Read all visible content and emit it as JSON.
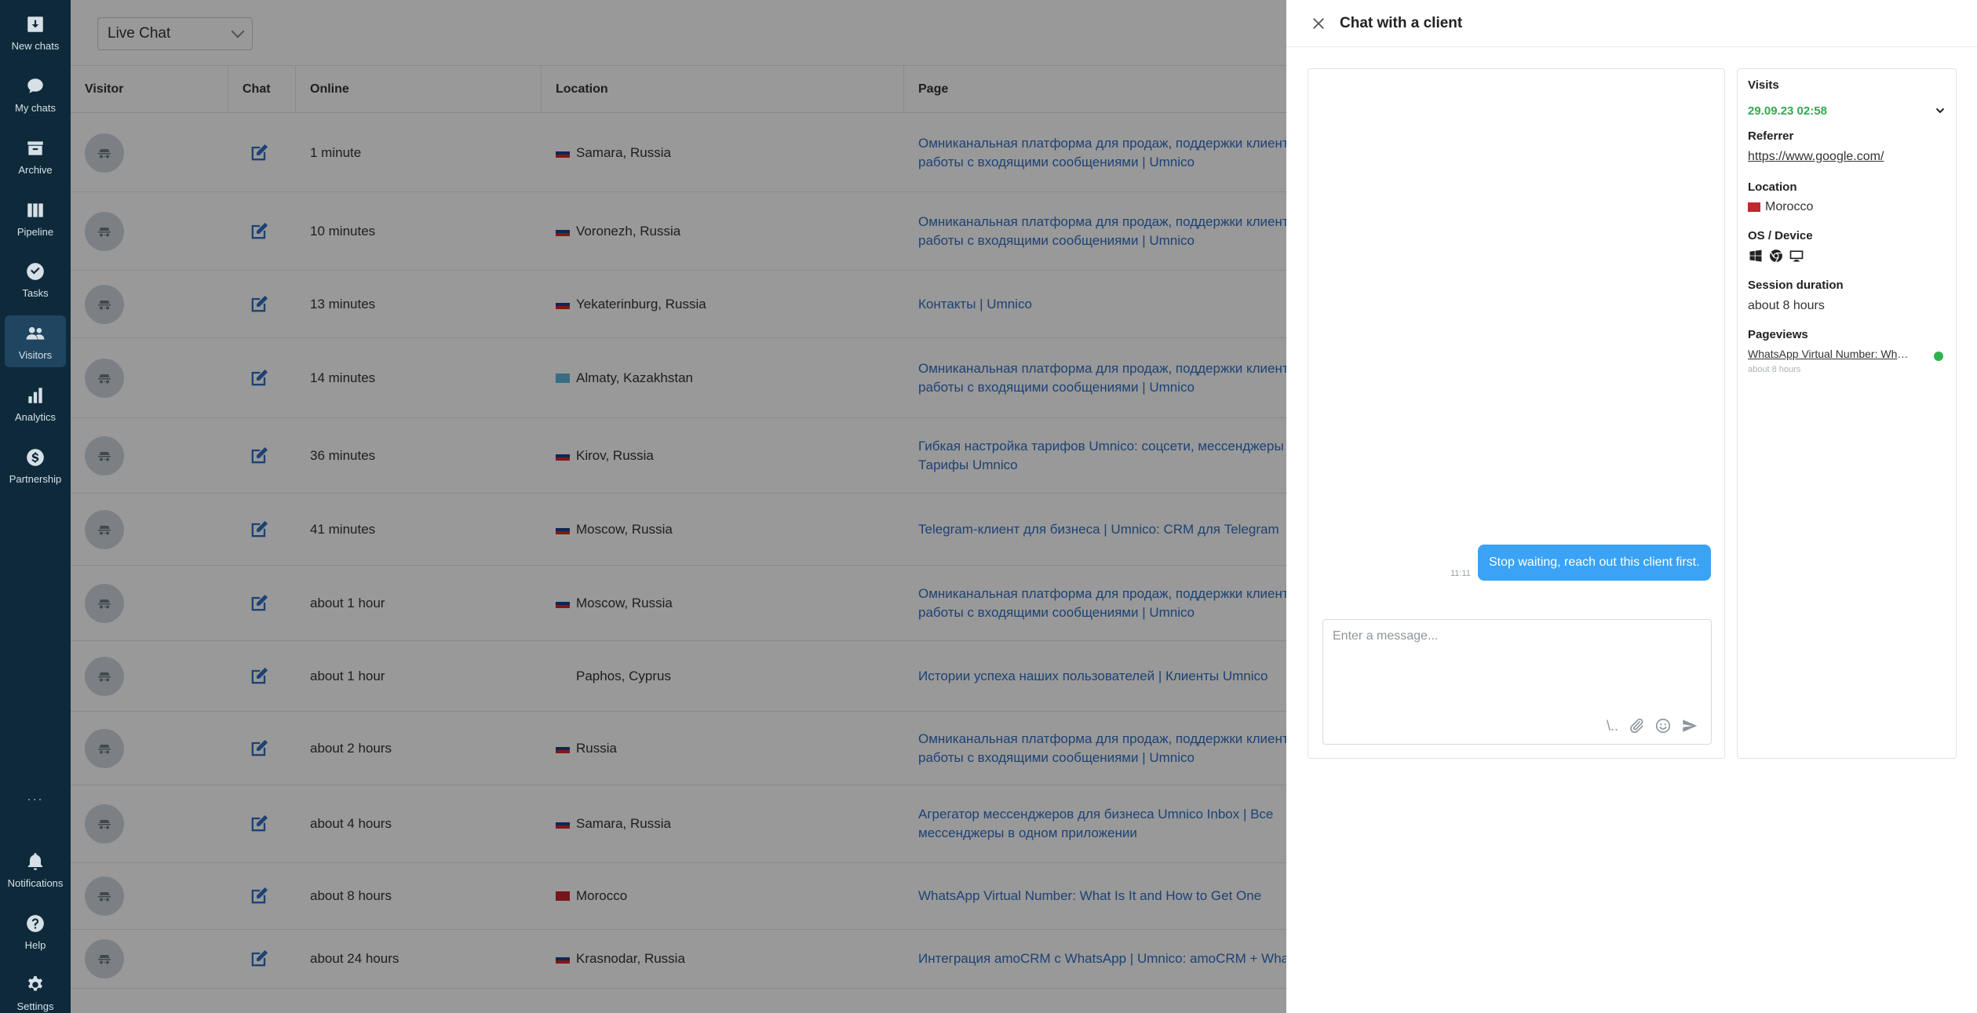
{
  "sidebar": {
    "items": [
      {
        "label": "New chats",
        "icon": "download-icon"
      },
      {
        "label": "My chats",
        "icon": "chat-bubble-icon"
      },
      {
        "label": "Archive",
        "icon": "archive-icon"
      },
      {
        "label": "Pipeline",
        "icon": "pipeline-icon"
      },
      {
        "label": "Tasks",
        "icon": "check-circle-icon"
      },
      {
        "label": "Visitors",
        "icon": "users-icon",
        "active": true
      },
      {
        "label": "Analytics",
        "icon": "bar-chart-icon"
      },
      {
        "label": "Partnership",
        "icon": "dollar-icon"
      },
      {
        "label": "Notifications",
        "icon": "bell-icon"
      },
      {
        "label": "Help",
        "icon": "question-icon"
      },
      {
        "label": "Settings",
        "icon": "gear-icon"
      }
    ],
    "more": "..."
  },
  "toolbar": {
    "channel_select": "Live Chat"
  },
  "table": {
    "headers": {
      "visitor": "Visitor",
      "chat": "Chat",
      "online": "Online",
      "location": "Location",
      "page": "Page"
    },
    "rows": [
      {
        "online": "1 minute",
        "location": "Samara, Russia",
        "flag": "ru",
        "page_l1": "Омниканальная платформа для продаж, поддержки клиент",
        "page_l2": "работы с входящими сообщениями | Umnico"
      },
      {
        "online": "10 minutes",
        "location": "Voronezh, Russia",
        "flag": "ru",
        "page_l1": "Омниканальная платформа для продаж, поддержки клиент",
        "page_l2": "работы с входящими сообщениями | Umnico"
      },
      {
        "online": "13 minutes",
        "location": "Yekaterinburg, Russia",
        "flag": "ru",
        "page_l1": "Контакты | Umnico",
        "page_l2": ""
      },
      {
        "online": "14 minutes",
        "location": "Almaty, Kazakhstan",
        "flag": "kz",
        "page_l1": "Омниканальная платформа для продаж, поддержки клиент",
        "page_l2": "работы с входящими сообщениями | Umnico"
      },
      {
        "online": "36 minutes",
        "location": "Kirov, Russia",
        "flag": "ru",
        "page_l1": "Гибкая настройка тарифов Umnico: соцсети, мессенджеры",
        "page_l2": "Тарифы Umnico"
      },
      {
        "online": "41 minutes",
        "location": "Moscow, Russia",
        "flag": "ru",
        "page_l1": "Telegram-клиент для бизнеса | Umnico: CRM для Telegram",
        "page_l2": ""
      },
      {
        "online": "about 1 hour",
        "location": "Moscow, Russia",
        "flag": "ru",
        "page_l1": "Омниканальная платформа для продаж, поддержки клиент",
        "page_l2": "работы с входящими сообщениями | Umnico"
      },
      {
        "online": "about 1 hour",
        "location": "Paphos, Cyprus",
        "flag": "cy",
        "page_l1": "Истории успеха наших пользователей | Клиенты Umnico",
        "page_l2": ""
      },
      {
        "online": "about 2 hours",
        "location": "Russia",
        "flag": "ru",
        "page_l1": "Омниканальная платформа для продаж, поддержки клиент",
        "page_l2": "работы с входящими сообщениями | Umnico"
      },
      {
        "online": "about 4 hours",
        "location": "Samara, Russia",
        "flag": "ru",
        "page_l1": "Агрегатор мессенджеров для бизнеса Umnico Inbox | Все",
        "page_l2": "мессенджеры в одном приложении"
      },
      {
        "online": "about 8 hours",
        "location": "Morocco",
        "flag": "ma",
        "page_l1": "WhatsApp Virtual Number: What Is It and How to Get One",
        "page_l2": ""
      },
      {
        "online": "about 24 hours",
        "location": "Krasnodar, Russia",
        "flag": "ru",
        "page_l1": "Интеграция amoCRM с WhatsApp | Umnico: amoCRM + Wha",
        "page_l2": ""
      }
    ]
  },
  "drawer": {
    "title": "Chat with a client",
    "message": {
      "time": "11:11",
      "text": "Stop waiting, reach out this client first."
    },
    "composer": {
      "placeholder": "Enter a message...",
      "slash": "\\.."
    },
    "info": {
      "visits_label": "Visits",
      "visit_date": "29.09.23 02:58",
      "referrer_label": "Referrer",
      "referrer": "https://www.google.com/",
      "location_label": "Location",
      "location": "Morocco",
      "os_label": "OS / Device",
      "session_label": "Session duration",
      "session": "about 8 hours",
      "pageviews_label": "Pageviews",
      "pageview_title": "WhatsApp Virtual Number: What Is It and How to Get One",
      "pageview_time": "about 8 hours"
    }
  },
  "colors": {
    "sidebar": "#0e2a3a",
    "link": "#2f6fc2",
    "bubble": "#3aa3f5",
    "visit_date": "#33a852",
    "online_dot": "#2eb34a"
  }
}
